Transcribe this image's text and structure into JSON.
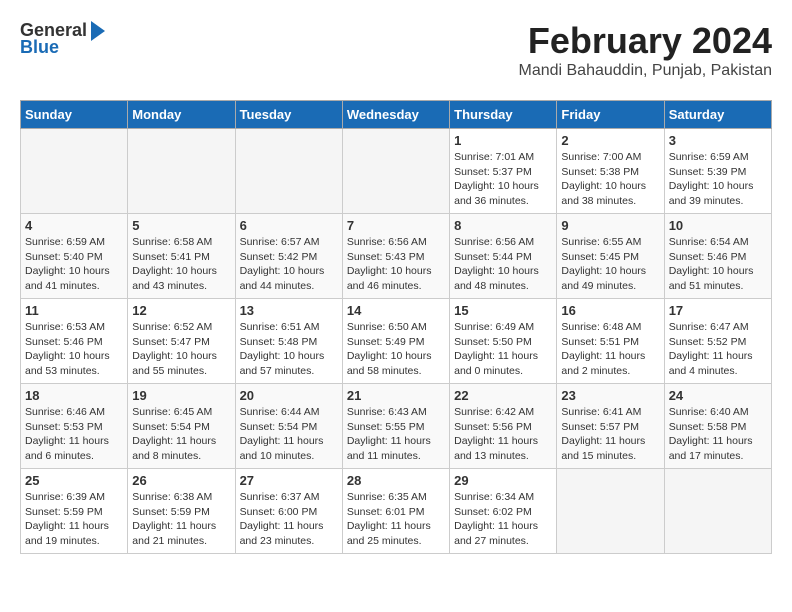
{
  "logo": {
    "general": "General",
    "blue": "Blue"
  },
  "header": {
    "title": "February 2024",
    "subtitle": "Mandi Bahauddin, Punjab, Pakistan"
  },
  "days_of_week": [
    "Sunday",
    "Monday",
    "Tuesday",
    "Wednesday",
    "Thursday",
    "Friday",
    "Saturday"
  ],
  "weeks": [
    [
      {
        "day": "",
        "detail": ""
      },
      {
        "day": "",
        "detail": ""
      },
      {
        "day": "",
        "detail": ""
      },
      {
        "day": "",
        "detail": ""
      },
      {
        "day": "1",
        "detail": "Sunrise: 7:01 AM\nSunset: 5:37 PM\nDaylight: 10 hours\nand 36 minutes."
      },
      {
        "day": "2",
        "detail": "Sunrise: 7:00 AM\nSunset: 5:38 PM\nDaylight: 10 hours\nand 38 minutes."
      },
      {
        "day": "3",
        "detail": "Sunrise: 6:59 AM\nSunset: 5:39 PM\nDaylight: 10 hours\nand 39 minutes."
      }
    ],
    [
      {
        "day": "4",
        "detail": "Sunrise: 6:59 AM\nSunset: 5:40 PM\nDaylight: 10 hours\nand 41 minutes."
      },
      {
        "day": "5",
        "detail": "Sunrise: 6:58 AM\nSunset: 5:41 PM\nDaylight: 10 hours\nand 43 minutes."
      },
      {
        "day": "6",
        "detail": "Sunrise: 6:57 AM\nSunset: 5:42 PM\nDaylight: 10 hours\nand 44 minutes."
      },
      {
        "day": "7",
        "detail": "Sunrise: 6:56 AM\nSunset: 5:43 PM\nDaylight: 10 hours\nand 46 minutes."
      },
      {
        "day": "8",
        "detail": "Sunrise: 6:56 AM\nSunset: 5:44 PM\nDaylight: 10 hours\nand 48 minutes."
      },
      {
        "day": "9",
        "detail": "Sunrise: 6:55 AM\nSunset: 5:45 PM\nDaylight: 10 hours\nand 49 minutes."
      },
      {
        "day": "10",
        "detail": "Sunrise: 6:54 AM\nSunset: 5:46 PM\nDaylight: 10 hours\nand 51 minutes."
      }
    ],
    [
      {
        "day": "11",
        "detail": "Sunrise: 6:53 AM\nSunset: 5:46 PM\nDaylight: 10 hours\nand 53 minutes."
      },
      {
        "day": "12",
        "detail": "Sunrise: 6:52 AM\nSunset: 5:47 PM\nDaylight: 10 hours\nand 55 minutes."
      },
      {
        "day": "13",
        "detail": "Sunrise: 6:51 AM\nSunset: 5:48 PM\nDaylight: 10 hours\nand 57 minutes."
      },
      {
        "day": "14",
        "detail": "Sunrise: 6:50 AM\nSunset: 5:49 PM\nDaylight: 10 hours\nand 58 minutes."
      },
      {
        "day": "15",
        "detail": "Sunrise: 6:49 AM\nSunset: 5:50 PM\nDaylight: 11 hours\nand 0 minutes."
      },
      {
        "day": "16",
        "detail": "Sunrise: 6:48 AM\nSunset: 5:51 PM\nDaylight: 11 hours\nand 2 minutes."
      },
      {
        "day": "17",
        "detail": "Sunrise: 6:47 AM\nSunset: 5:52 PM\nDaylight: 11 hours\nand 4 minutes."
      }
    ],
    [
      {
        "day": "18",
        "detail": "Sunrise: 6:46 AM\nSunset: 5:53 PM\nDaylight: 11 hours\nand 6 minutes."
      },
      {
        "day": "19",
        "detail": "Sunrise: 6:45 AM\nSunset: 5:54 PM\nDaylight: 11 hours\nand 8 minutes."
      },
      {
        "day": "20",
        "detail": "Sunrise: 6:44 AM\nSunset: 5:54 PM\nDaylight: 11 hours\nand 10 minutes."
      },
      {
        "day": "21",
        "detail": "Sunrise: 6:43 AM\nSunset: 5:55 PM\nDaylight: 11 hours\nand 11 minutes."
      },
      {
        "day": "22",
        "detail": "Sunrise: 6:42 AM\nSunset: 5:56 PM\nDaylight: 11 hours\nand 13 minutes."
      },
      {
        "day": "23",
        "detail": "Sunrise: 6:41 AM\nSunset: 5:57 PM\nDaylight: 11 hours\nand 15 minutes."
      },
      {
        "day": "24",
        "detail": "Sunrise: 6:40 AM\nSunset: 5:58 PM\nDaylight: 11 hours\nand 17 minutes."
      }
    ],
    [
      {
        "day": "25",
        "detail": "Sunrise: 6:39 AM\nSunset: 5:59 PM\nDaylight: 11 hours\nand 19 minutes."
      },
      {
        "day": "26",
        "detail": "Sunrise: 6:38 AM\nSunset: 5:59 PM\nDaylight: 11 hours\nand 21 minutes."
      },
      {
        "day": "27",
        "detail": "Sunrise: 6:37 AM\nSunset: 6:00 PM\nDaylight: 11 hours\nand 23 minutes."
      },
      {
        "day": "28",
        "detail": "Sunrise: 6:35 AM\nSunset: 6:01 PM\nDaylight: 11 hours\nand 25 minutes."
      },
      {
        "day": "29",
        "detail": "Sunrise: 6:34 AM\nSunset: 6:02 PM\nDaylight: 11 hours\nand 27 minutes."
      },
      {
        "day": "",
        "detail": ""
      },
      {
        "day": "",
        "detail": ""
      }
    ]
  ]
}
